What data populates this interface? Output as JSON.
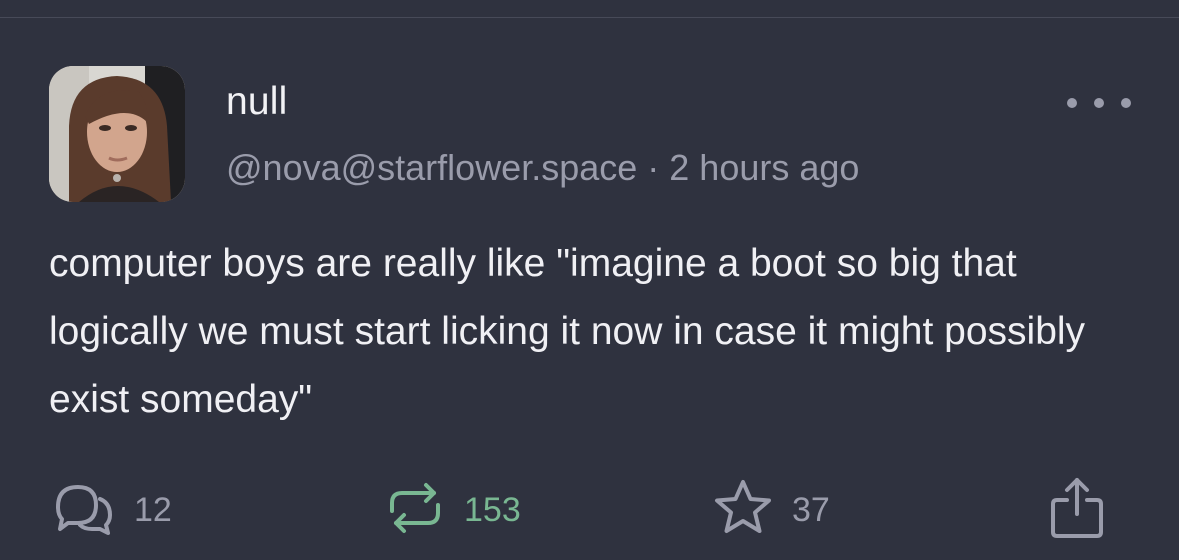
{
  "post": {
    "author": {
      "display_name": "null",
      "handle": "@nova@starflower.space"
    },
    "separator": "·",
    "timestamp": "2 hours ago",
    "text": "computer boys are really like \"imagine a boot so big that logically we must start licking it now in case it might possibly exist someday\"",
    "actions": {
      "reply": {
        "icon": "reply-bubbles-icon",
        "count": "12"
      },
      "boost": {
        "icon": "boost-arrows-icon",
        "count": "153",
        "active": true
      },
      "favourite": {
        "icon": "star-icon",
        "count": "37"
      },
      "share": {
        "icon": "share-icon"
      }
    },
    "more_menu_icon": "ellipsis-icon"
  },
  "colors": {
    "background": "#2f323f",
    "primary_text": "#f0f0f4",
    "muted_text": "#9a9cab",
    "boost_active": "#79b792",
    "divider": "#474a58"
  }
}
